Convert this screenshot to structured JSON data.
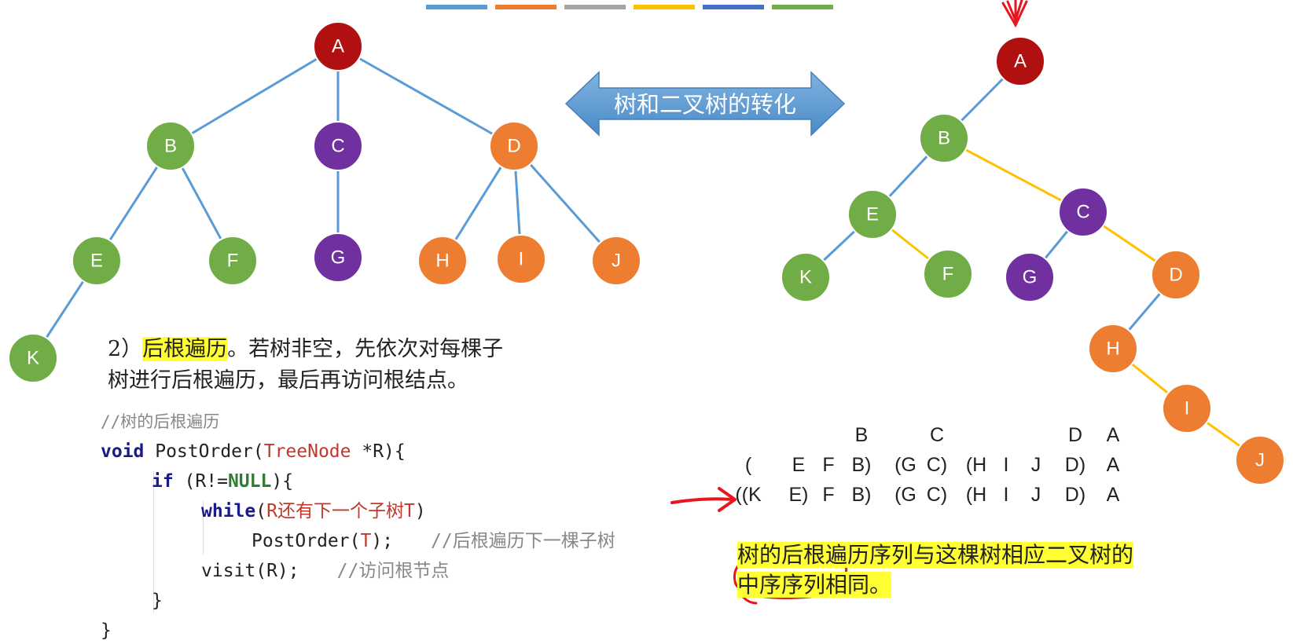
{
  "legend_colors": [
    "#5b9bd5",
    "#ed7d31",
    "#a5a5a5",
    "#ffc000",
    "#4472c4",
    "#70ad47"
  ],
  "colors": {
    "red": "#b01010",
    "green": "#70ad47",
    "purple": "#7030a0",
    "orange": "#ed7d31",
    "edge_blue": "#5b9bd5",
    "edge_yellow": "#ffc000",
    "arrow_blue": "#5b9bd5",
    "highlight": "#ffff33",
    "pen_red": "#e8141e"
  },
  "tree_nodes": [
    {
      "id": "A",
      "label": "A",
      "color": "red"
    },
    {
      "id": "B",
      "label": "B",
      "color": "green"
    },
    {
      "id": "C",
      "label": "C",
      "color": "purple"
    },
    {
      "id": "D",
      "label": "D",
      "color": "orange"
    },
    {
      "id": "E",
      "label": "E",
      "color": "green"
    },
    {
      "id": "F",
      "label": "F",
      "color": "green"
    },
    {
      "id": "G",
      "label": "G",
      "color": "purple"
    },
    {
      "id": "H",
      "label": "H",
      "color": "orange"
    },
    {
      "id": "I",
      "label": "I",
      "color": "orange"
    },
    {
      "id": "J",
      "label": "J",
      "color": "orange"
    },
    {
      "id": "K",
      "label": "K",
      "color": "green"
    }
  ],
  "tree_edges": [
    [
      "A",
      "B"
    ],
    [
      "A",
      "C"
    ],
    [
      "A",
      "D"
    ],
    [
      "B",
      "E"
    ],
    [
      "B",
      "F"
    ],
    [
      "C",
      "G"
    ],
    [
      "D",
      "H"
    ],
    [
      "D",
      "I"
    ],
    [
      "D",
      "J"
    ],
    [
      "E",
      "K"
    ]
  ],
  "arrow_label": "树和二叉树的转化",
  "binary_nodes": [
    {
      "id": "A",
      "label": "A",
      "color": "red"
    },
    {
      "id": "B",
      "label": "B",
      "color": "green"
    },
    {
      "id": "C",
      "label": "C",
      "color": "purple"
    },
    {
      "id": "D",
      "label": "D",
      "color": "orange"
    },
    {
      "id": "E",
      "label": "E",
      "color": "green"
    },
    {
      "id": "F",
      "label": "F",
      "color": "green"
    },
    {
      "id": "G",
      "label": "G",
      "color": "purple"
    },
    {
      "id": "H",
      "label": "H",
      "color": "orange"
    },
    {
      "id": "I",
      "label": "I",
      "color": "orange"
    },
    {
      "id": "J",
      "label": "J",
      "color": "orange"
    },
    {
      "id": "K",
      "label": "K",
      "color": "green"
    }
  ],
  "binary_edges": [
    {
      "from": "A",
      "to": "B",
      "kind": "left"
    },
    {
      "from": "B",
      "to": "E",
      "kind": "left"
    },
    {
      "from": "B",
      "to": "C",
      "kind": "right"
    },
    {
      "from": "E",
      "to": "K",
      "kind": "left"
    },
    {
      "from": "E",
      "to": "F",
      "kind": "right"
    },
    {
      "from": "C",
      "to": "G",
      "kind": "left"
    },
    {
      "from": "C",
      "to": "D",
      "kind": "right"
    },
    {
      "from": "D",
      "to": "H",
      "kind": "left"
    },
    {
      "from": "H",
      "to": "I",
      "kind": "right"
    },
    {
      "from": "I",
      "to": "J",
      "kind": "right"
    }
  ],
  "description": {
    "prefix": "2）",
    "highlight": "后根遍历",
    "rest_line1": "。若树非空，先依次对每棵子",
    "line2": "树进行后根遍历，最后再访问根结点。"
  },
  "code": {
    "comment_title": "//树的后根遍历",
    "l1_void": "void",
    "l1_fn": " PostOrder(",
    "l1_type": "TreeNode",
    "l1_rest": " *R){",
    "l2_if": "if",
    "l2_mid": " (R!=",
    "l2_null": "NULL",
    "l2_end": "){",
    "l3_while": "while",
    "l3_open": "(",
    "l3_cond": "R还有下一个子树T",
    "l3_close": ")",
    "l4_call": "PostOrder(",
    "l4_arg": "T",
    "l4_end": ");",
    "l4_comment": "//后根遍历下一棵子树",
    "l5_call": "visit(R);",
    "l5_comment": "//访问根节点",
    "l6": "}",
    "l7": "}"
  },
  "sequence_rows": [
    [
      "",
      "",
      "",
      "B",
      "",
      "C",
      "",
      "",
      "",
      "D",
      "A"
    ],
    [
      "(",
      "E",
      "F",
      "B)",
      "(G",
      "C)",
      "(H",
      "I",
      "J",
      "D)",
      "A"
    ],
    [
      "((K",
      "E)",
      "F",
      "B)",
      "(G",
      "C)",
      "(H",
      "I",
      "J",
      "D)",
      "A"
    ]
  ],
  "conclusion": {
    "line1": "树的后根遍历序列与这棵树相应二叉树的",
    "line2_a": "中序序列",
    "line2_b": "相同。"
  }
}
